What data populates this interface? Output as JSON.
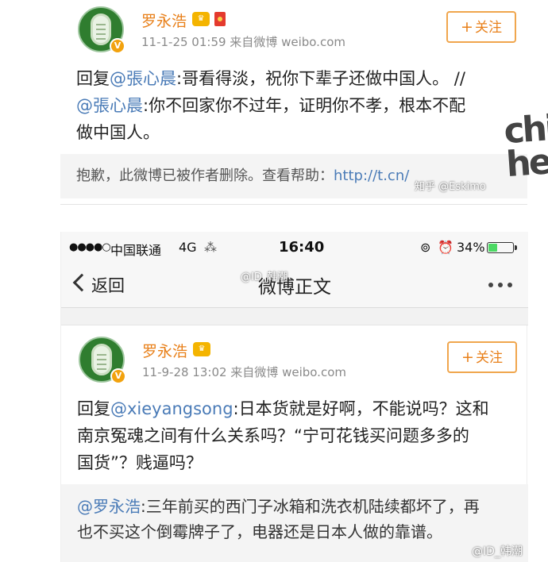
{
  "post1": {
    "username": "罗永浩",
    "meta": "11-1-25 01:59  来自微博 weibo.com",
    "follow_label": "关注",
    "reply_prefix": "回复",
    "reply_mention": "@張心晨",
    "reply_text": ":哥看得淡，祝你下辈子还做中国人。 //",
    "quoted_mention": "@張心晨",
    "quoted_text_1": ":你不回家你不过年，证明你不孝，根本不配",
    "quoted_text_2": "做中国人。",
    "deleted_notice": "抱歉，此微博已被作者删除。查看帮助：",
    "deleted_link": "http://t.cn/",
    "watermark_chip": "chip",
    "watermark_hell": "hell",
    "watermark_zhihu": "知乎 @Eskimo"
  },
  "status_bar": {
    "signal": "●●●●○",
    "carrier": "中国联通",
    "network": "4G",
    "time": "16:40",
    "battery_pct": "34%",
    "battery_level": 0.34
  },
  "nav": {
    "back_label": "返回",
    "title": "微博正文",
    "watermark": "@ID_韩潮"
  },
  "post2": {
    "username": "罗永浩",
    "meta": "11-9-28 13:02  来自微博 weibo.com",
    "follow_label": "关注",
    "reply_prefix": "回复",
    "reply_mention": "@xieyangsong",
    "reply_text_1": ":日本货就是好啊，不能说吗？这和",
    "reply_text_2": "南京冤魂之间有什么关系吗？“宁可花钱买问题多多的",
    "reply_text_3": "国货”？贱逼吗？",
    "quoted_mention": "@罗永浩",
    "quoted_text_1": ":三年前买的西门子冰箱和洗衣机陆续都坏了，再",
    "quoted_text_2": "也不买这个倒霉牌子了，电器还是日本人做的靠谱。"
  },
  "corner_watermark": "@ID_韩潮",
  "colors": {
    "username": "#e8801a",
    "mention": "#4a7bb7",
    "follow_border": "#f0a64d"
  }
}
